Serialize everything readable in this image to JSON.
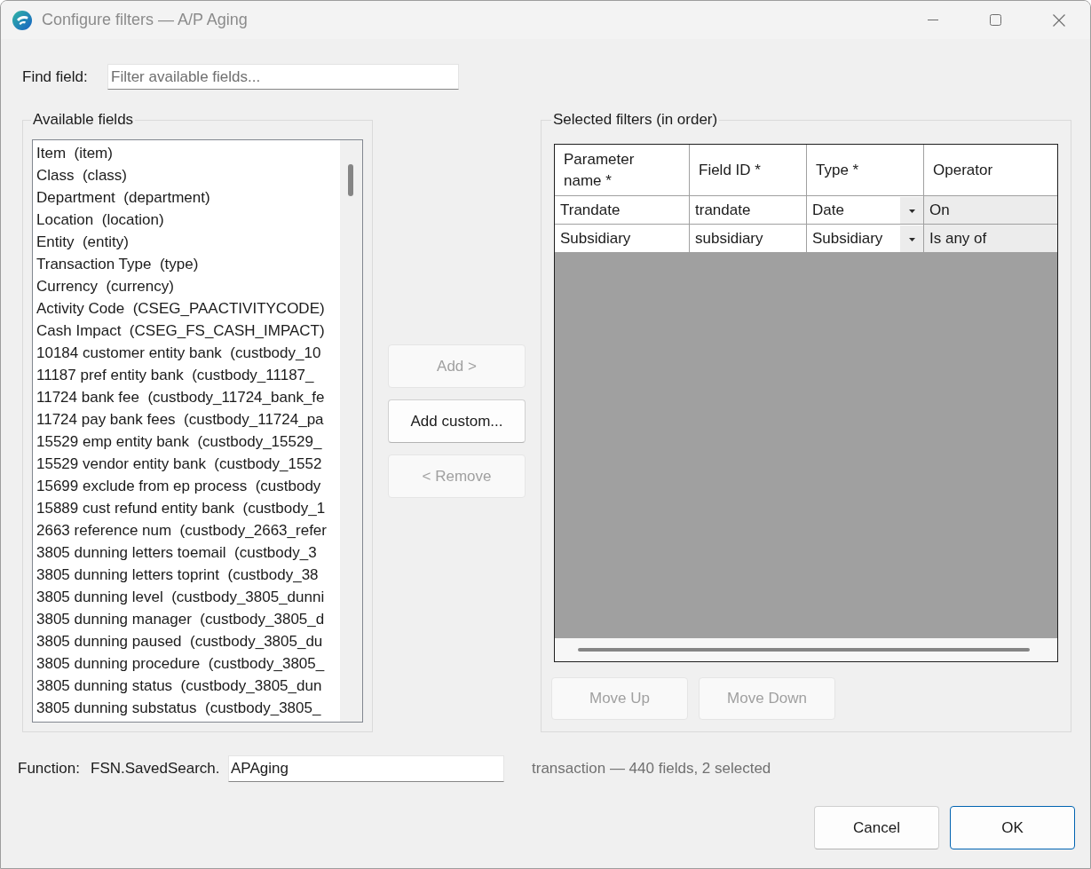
{
  "window": {
    "title": "Configure filters — A/P Aging"
  },
  "find_field": {
    "label": "Find field:",
    "placeholder": "Filter available fields..."
  },
  "available_fields": {
    "title": "Available fields",
    "items": [
      "Item  (item)",
      "Class  (class)",
      "Department  (department)",
      "Location  (location)",
      "Entity  (entity)",
      "Transaction Type  (type)",
      "Currency  (currency)",
      "Activity Code  (CSEG_PAACTIVITYCODE)",
      "Cash Impact  (CSEG_FS_CASH_IMPACT)",
      "10184 customer entity bank  (custbody_10",
      "11187 pref entity bank  (custbody_11187_",
      "11724 bank fee  (custbody_11724_bank_fe",
      "11724 pay bank fees  (custbody_11724_pa",
      "15529 emp entity bank  (custbody_15529_",
      "15529 vendor entity bank  (custbody_1552",
      "15699 exclude from ep process  (custbody",
      "15889 cust refund entity bank  (custbody_1",
      "2663 reference num  (custbody_2663_refer",
      "3805 dunning letters toemail  (custbody_3",
      "3805 dunning letters toprint  (custbody_38",
      "3805 dunning level  (custbody_3805_dunni",
      "3805 dunning manager  (custbody_3805_d",
      "3805 dunning paused  (custbody_3805_du",
      "3805 dunning procedure  (custbody_3805_",
      "3805 dunning status  (custbody_3805_dun",
      "3805 dunning substatus  (custbody_3805_"
    ]
  },
  "actions": [
    {
      "label": "Add >",
      "disabled": true
    },
    {
      "label": "Add custom...",
      "disabled": false
    },
    {
      "label": "< Remove",
      "disabled": true
    }
  ],
  "selected_filters": {
    "title": "Selected filters (in order)",
    "columns": [
      {
        "label": "Parameter name *",
        "kind": "text"
      },
      {
        "label": "Field ID *",
        "kind": "text"
      },
      {
        "label": "Type *",
        "kind": "dropdown"
      },
      {
        "label": "Operator",
        "kind": "readonly"
      }
    ],
    "rows": [
      [
        "Trandate",
        "trandate",
        "Date",
        "On"
      ],
      [
        "Subsidiary",
        "subsidiary",
        "Subsidiary",
        "Is any of"
      ]
    ],
    "buttons": [
      {
        "label": "Move Up",
        "disabled": true
      },
      {
        "label": "Move Down",
        "disabled": true
      }
    ]
  },
  "function": {
    "label": "Function:",
    "prefix": "FSN.SavedSearch.",
    "value": "APAging"
  },
  "status": "transaction — 440 fields, 2 selected",
  "buttons": [
    {
      "label": "Cancel",
      "default": false
    },
    {
      "label": "OK",
      "default": true
    }
  ]
}
